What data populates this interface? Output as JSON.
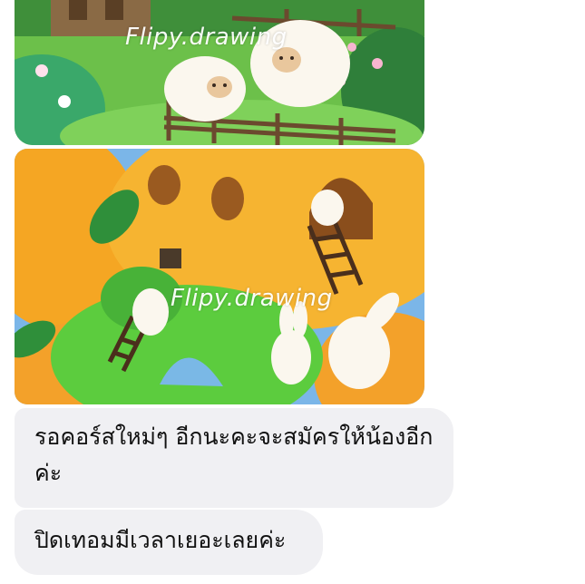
{
  "messages": [
    {
      "type": "image",
      "watermark": "Flipy.drawing"
    },
    {
      "type": "image",
      "watermark": "Flipy.drawing"
    },
    {
      "type": "text",
      "text": "รอคอร์สใหม่ๆ อีกนะคะจะสมัครให้น้องอีกค่ะ"
    },
    {
      "type": "text",
      "text": "ปิดเทอมมีเวลาเยอะเลยค่ะ"
    }
  ]
}
